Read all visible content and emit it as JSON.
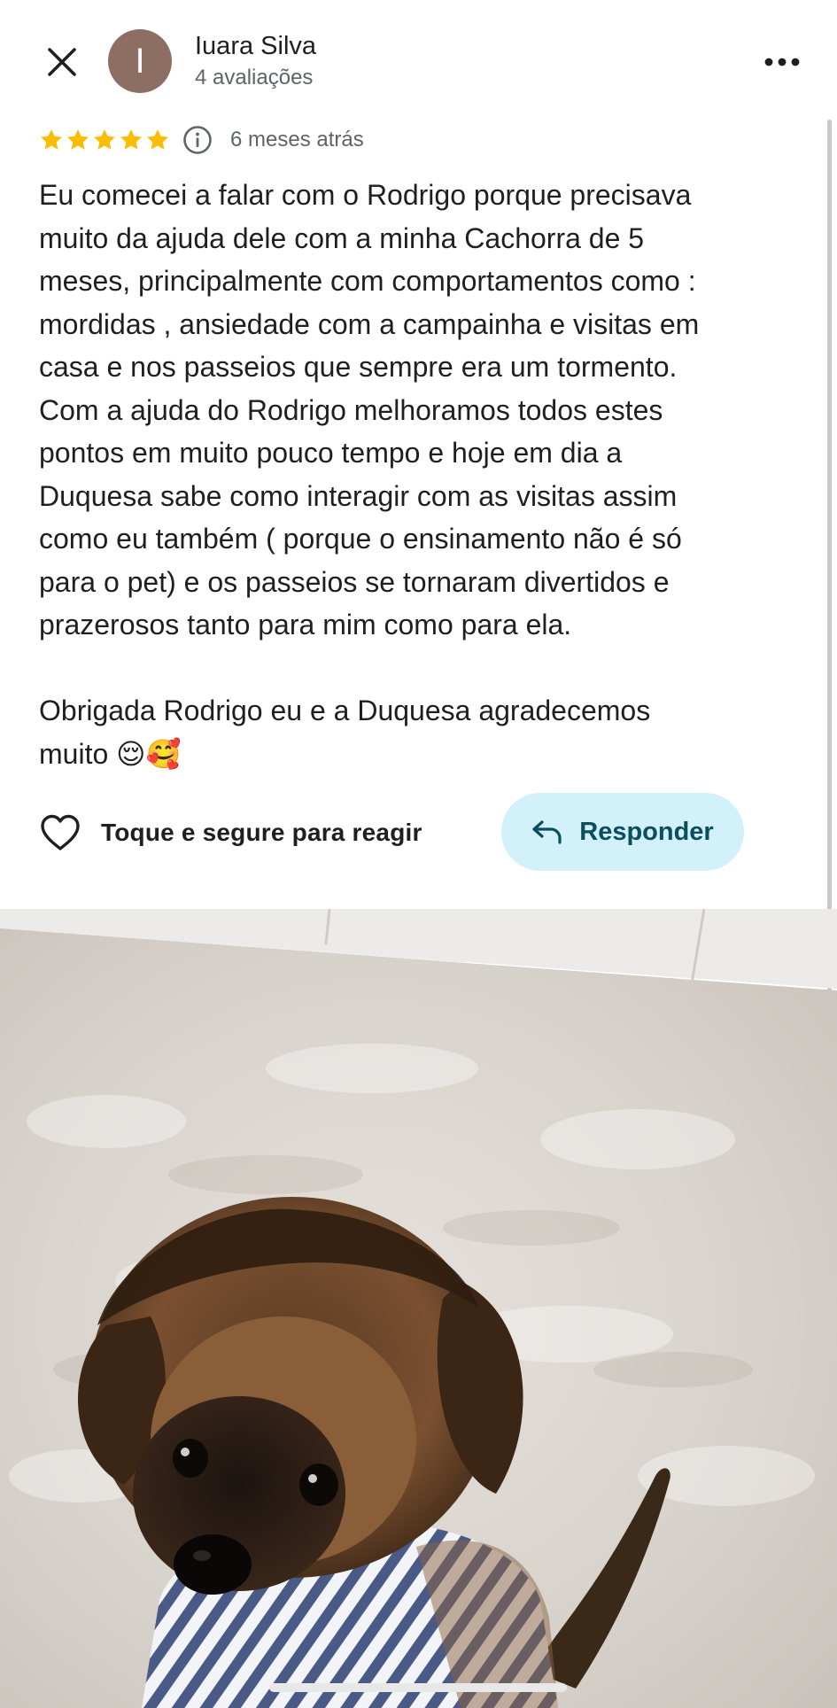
{
  "header": {
    "avatar_letter": "I",
    "author_name": "Iuara Silva",
    "author_reviews": "4 avaliações",
    "avatar_color": "#8d6e63"
  },
  "rating": {
    "stars": 5,
    "max_stars": 5,
    "star_color": "#fbbc04",
    "time_ago": "6 meses atrás"
  },
  "review": {
    "text": "Eu comecei a falar com o Rodrigo porque precisava\nmuito da ajuda dele com a minha Cachorra de 5\nmeses, principalmente com comportamentos como :\nmordidas , ansiedade com a campainha e visitas em\ncasa e nos passeios que sempre era um tormento.\nCom a ajuda do Rodrigo melhoramos todos estes\npontos em muito pouco tempo e hoje em dia a\nDuquesa sabe como interagir com as visitas assim\ncomo eu também ( porque o ensinamento não é só\npara o pet) e os passeios se tornaram divertidos e\nprazerosos tanto para mim como para ela.\n\nObrigada Rodrigo eu e a Duquesa agradecemos\nmuito 😌🥰"
  },
  "actions": {
    "react_label": "Toque e segure para reagir",
    "reply_label": "Responder",
    "reply_bg": "#d3f1fb"
  },
  "icons": {
    "close": "close-icon",
    "more": "more-horizontal-icon",
    "info": "info-icon",
    "heart": "heart-outline-icon",
    "reply": "reply-arrow-icon",
    "star": "star-icon"
  }
}
